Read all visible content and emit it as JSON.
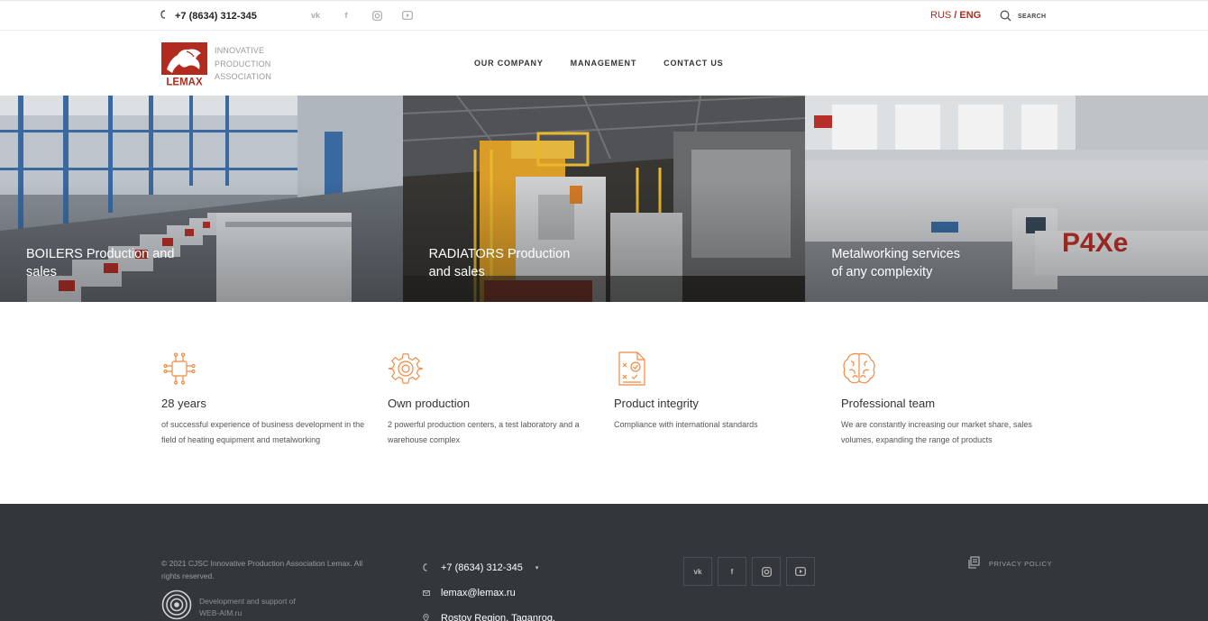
{
  "topbar": {
    "phone": "+7 (8634) 312-345",
    "social": [
      {
        "icon": "vk-icon",
        "glyph": "vk"
      },
      {
        "icon": "facebook-icon",
        "glyph": "f"
      },
      {
        "icon": "instagram-icon",
        "glyph": ""
      },
      {
        "icon": "youtube-icon",
        "glyph": ""
      }
    ],
    "lang_rus": "RUS",
    "lang_sep": "/",
    "lang_eng": "ENG",
    "search_label": "SEARCH"
  },
  "header": {
    "logo_text": "LEMAX",
    "tagline_1": "INNOVATIVE",
    "tagline_2": "PRODUCTION",
    "tagline_3": "ASSOCIATION",
    "nav": [
      "OUR COMPANY",
      "MANAGEMENT",
      "CONTACT US"
    ]
  },
  "hero": {
    "panels": [
      {
        "line1": "BOILERS Production and",
        "line2": "sales"
      },
      {
        "line1": "RADIATORS Production",
        "line2": "and sales"
      },
      {
        "line1": "Metalworking services",
        "line2": "of any complexity"
      }
    ]
  },
  "features": [
    {
      "icon": "chip-icon",
      "title": "28 years",
      "desc": "of successful experience of business development in the field of heating equipment and metalworking"
    },
    {
      "icon": "gear-icon",
      "title": "Own production",
      "desc": "2 powerful production centers, a test laboratory and a warehouse complex"
    },
    {
      "icon": "checklist-icon",
      "title": "Product integrity",
      "desc": "Compliance with international standards"
    },
    {
      "icon": "brain-icon",
      "title": "Professional team",
      "desc": "We are constantly increasing our market share, sales volumes, expanding the range of products"
    }
  ],
  "footer": {
    "copyright": "© 2021 CJSC Innovative Production Association Lemax. All rights reserved.",
    "dev_line1": "Development and support of",
    "dev_line2": "WEB-AIM.ru",
    "phone": "+7 (8634) 312-345",
    "email": "lemax@lemax.ru",
    "address": "Rostov Region, Taganrog,",
    "privacy": "PRIVACY POLICY"
  },
  "colors": {
    "brand_red": "#b22b1f",
    "accent_orange": "#f0893f",
    "footer_bg": "#33363b"
  }
}
